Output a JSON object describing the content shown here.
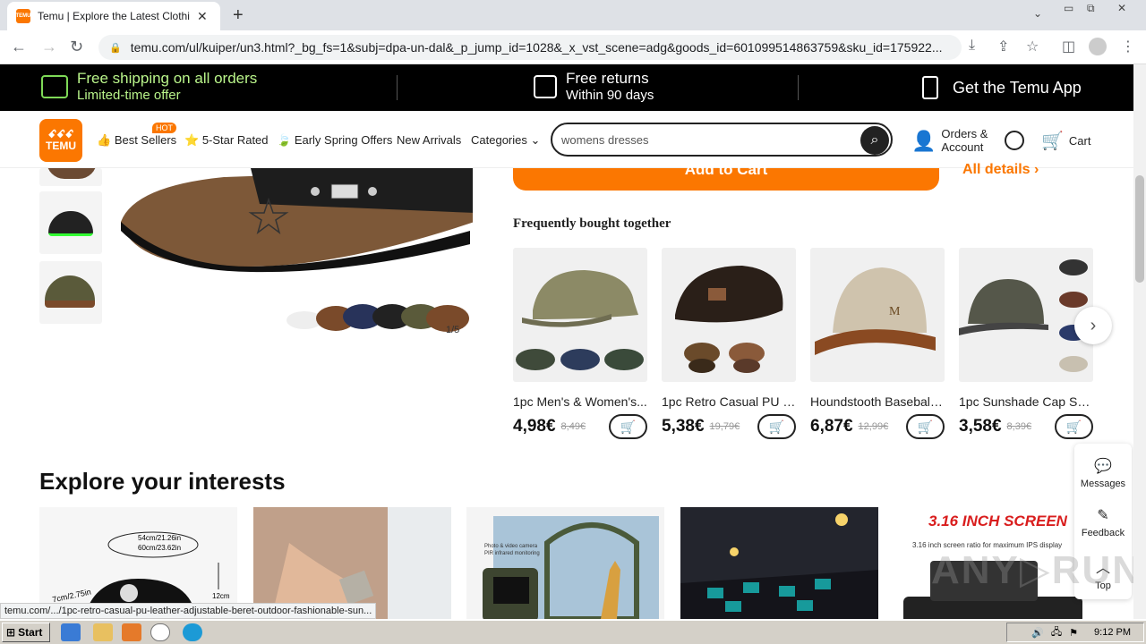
{
  "browser": {
    "tab_title": "Temu | Explore the Latest Clothing, B",
    "tab_close": "✕",
    "new_tab": "+",
    "url": "temu.com/ul/kuiper/un3.html?_bg_fs=1&subj=dpa-un-dal&_p_jump_id=1028&_x_vst_scene=adg&goods_id=601099514863759&sku_id=175922...",
    "status_url": "temu.com/.../1pc-retro-casual-pu-leather-adjustable-beret-outdoor-fashionable-sun..."
  },
  "promo": {
    "shipping_line1": "Free shipping on all orders",
    "shipping_line2": "Limited-time offer",
    "returns_line1": "Free returns",
    "returns_line2": "Within 90 days",
    "app": "Get the Temu App"
  },
  "header": {
    "logo_top": "ꗃꗃꗃ",
    "logo_text": "TEMU",
    "nav": {
      "best_sellers": "Best Sellers",
      "hot_badge": "HOT",
      "five_star": "5-Star Rated",
      "early_spring": "Early Spring Offers",
      "new_arrivals": "New Arrivals",
      "categories": "Categories"
    },
    "search_value": "womens dresses",
    "orders_line1": "Orders &",
    "orders_line2": "Account",
    "cart": "Cart"
  },
  "product": {
    "image_counter": "1/5",
    "add_to_cart": "Add to Cart",
    "all_details": "All details ›"
  },
  "fbt": {
    "title": "Frequently bought together",
    "items": [
      {
        "name": "1pc Men's & Women's...",
        "price": "4,98€",
        "old": "8,49€"
      },
      {
        "name": "1pc Retro Casual PU L...",
        "price": "5,38€",
        "old": "19,79€"
      },
      {
        "name": "Houndstooth Baseball ...",
        "price": "6,87€",
        "old": "12,99€"
      },
      {
        "name": "1pc Sunshade Cap Sol...",
        "price": "3,58€",
        "old": "8,39€"
      }
    ]
  },
  "explore": {
    "title": "Explore your interests",
    "card1_text1": "54cm/21.26in",
    "card1_text2": "60cm/23.62in",
    "card1_text3": "7cm/2.75in",
    "card1_text4": "12cm",
    "card3_text": "Photo & video camera PIR infrared monitoring",
    "card5_title": "3.16 INCH SCREEN",
    "card5_sub": "3.16 inch screen ratio for maximum IPS display"
  },
  "sidewidget": {
    "messages": "Messages",
    "feedback": "Feedback",
    "top": "Top"
  },
  "watermark": "ANY▷RUN",
  "taskbar": {
    "start": "Start",
    "time": "9:12 PM"
  },
  "colors": {
    "brand": "#fb7701",
    "promo_bg": "#000000",
    "promo_green": "#b9f48a"
  }
}
